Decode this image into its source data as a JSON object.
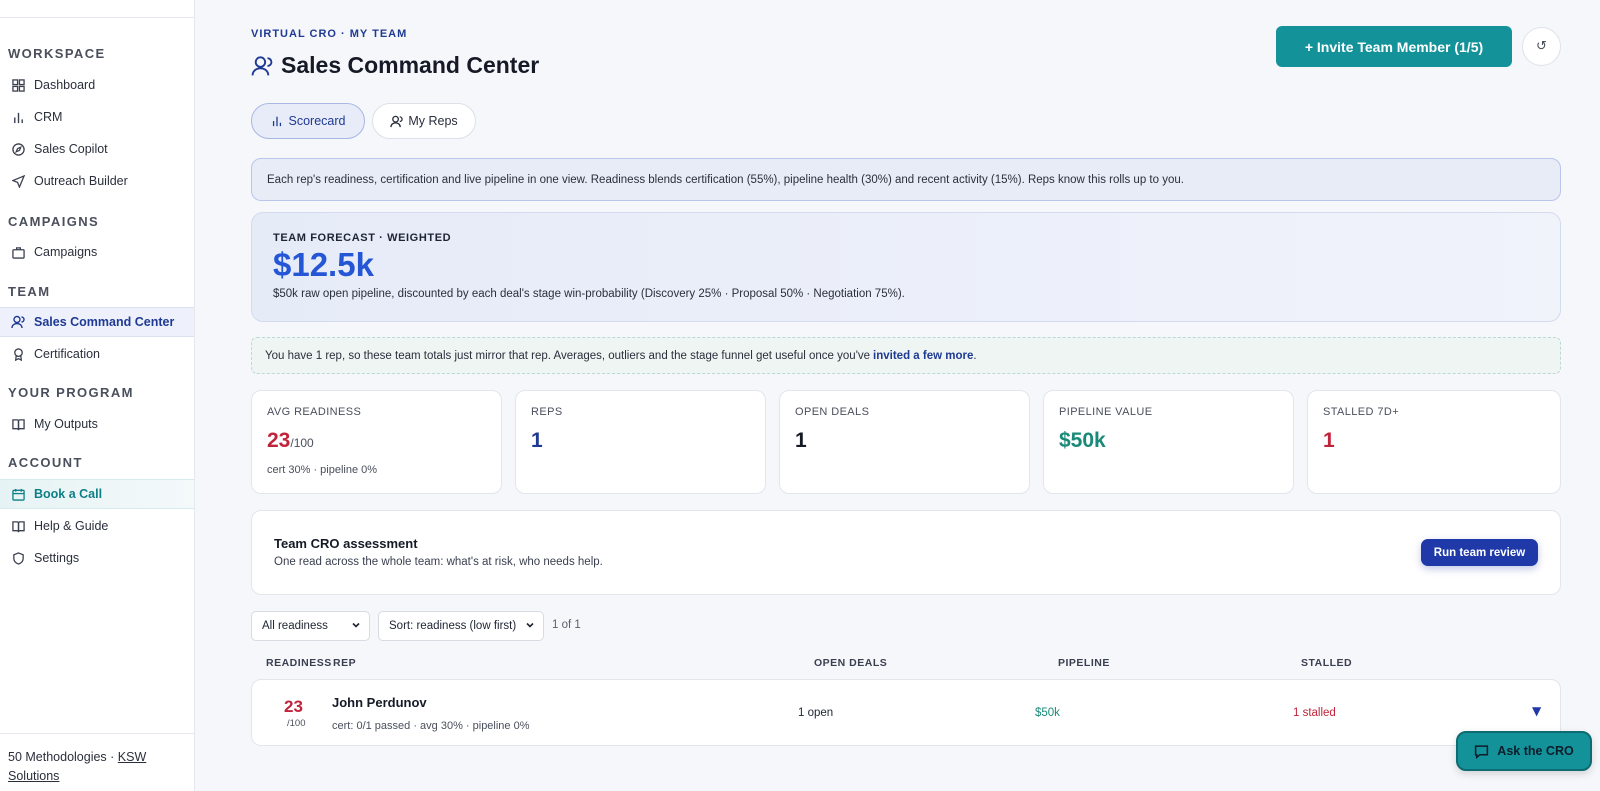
{
  "sidebar": {
    "sections": {
      "workspace": "WORKSPACE",
      "campaigns": "CAMPAIGNS",
      "team": "TEAM",
      "program": "YOUR PROGRAM",
      "account": "ACCOUNT"
    },
    "items": {
      "dashboard": "Dashboard",
      "crm": "CRM",
      "sales_copilot": "Sales Copilot",
      "outreach_builder": "Outreach Builder",
      "campaigns": "Campaigns",
      "sales_command_center": "Sales Command Center",
      "certification": "Certification",
      "my_outputs": "My Outputs",
      "book_a_call": "Book a Call",
      "help_guide": "Help & Guide",
      "settings": "Settings"
    },
    "footer": {
      "text": "50 Methodologies · ",
      "link_line1": "KSW",
      "link_line2": "Solutions"
    }
  },
  "header": {
    "eyebrow": "VIRTUAL CRO · MY TEAM",
    "title": "Sales Command Center",
    "invite_label": "+ Invite Team Member (1/5)",
    "refresh_glyph": "↺"
  },
  "tabs": {
    "scorecard": "Scorecard",
    "my_reps": "My Reps"
  },
  "info_banner": "Each rep's readiness, certification and live pipeline in one view. Readiness blends certification (55%), pipeline health (30%) and recent activity (15%). Reps know this rolls up to you.",
  "forecast": {
    "label": "TEAM FORECAST · WEIGHTED",
    "value": "$12.5k",
    "description": "$50k raw open pipeline, discounted by each deal's stage win-probability (Discovery 25% · Proposal 50% · Negotiation 75%)."
  },
  "note": {
    "text": "You have 1 rep, so these team totals just mirror that rep. Averages, outliers and the stage funnel get useful once you've",
    "link": "invited a few more",
    "end": "."
  },
  "stats": {
    "avg_readiness": {
      "label": "AVG READINESS",
      "value": "23",
      "denom": "/100",
      "sub": "cert 30% · pipeline 0%"
    },
    "reps": {
      "label": "REPS",
      "value": "1"
    },
    "open_deals": {
      "label": "OPEN DEALS",
      "value": "1"
    },
    "pipeline_value": {
      "label": "PIPELINE VALUE",
      "value": "$50k"
    },
    "stalled": {
      "label": "STALLED 7D+",
      "value": "1"
    }
  },
  "assessment": {
    "title": "Team CRO assessment",
    "subtitle": "One read across the whole team: what's at risk, who needs help.",
    "button": "Run team review"
  },
  "filters": {
    "readiness": "All readiness",
    "sort": "Sort: readiness (low first)",
    "count": "1 of 1"
  },
  "table": {
    "headers": {
      "readiness": "READINESS",
      "rep": "REP",
      "open_deals": "OPEN DEALS",
      "pipeline": "PIPELINE",
      "stalled": "STALLED"
    },
    "rows": [
      {
        "score": "23",
        "denom": "/100",
        "name": "John Perdunov",
        "sub": "cert: 0/1 passed · avg 30% · pipeline 0%",
        "open_deals": "1 open",
        "pipeline": "$50k",
        "stalled": "1 stalled",
        "expand": "▼"
      }
    ]
  },
  "ask_cro": "Ask the CRO",
  "colors": {
    "accent_teal": "#14929a",
    "accent_navy": "#1f3a93",
    "danger": "#c0243a",
    "success": "#1a8a78",
    "forecast_blue": "#2456d6"
  },
  "icons": {
    "dashboard": "grid-icon",
    "crm": "bar-chart-icon",
    "sales_copilot": "compass-icon",
    "outreach_builder": "send-icon",
    "campaigns": "briefcase-icon",
    "sales_command_center": "user-icon",
    "certification": "award-icon",
    "my_outputs": "book-icon",
    "book_a_call": "calendar-icon",
    "help_guide": "book-open-icon",
    "settings": "shield-icon"
  }
}
